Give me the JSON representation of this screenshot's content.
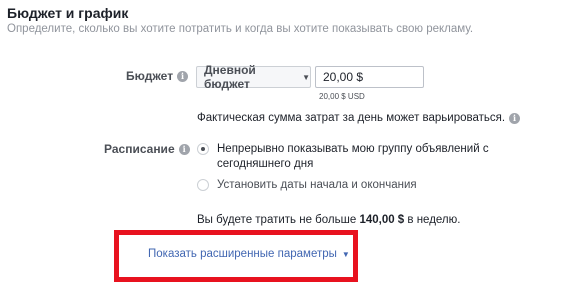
{
  "section": {
    "title": "Бюджет и график",
    "subtitle": "Определите, сколько вы хотите потратить и когда вы хотите показывать свою рекламу."
  },
  "budget": {
    "label": "Бюджет",
    "type_select": "Дневной бюджет",
    "amount_value": "20,00 $",
    "amount_usd": "20,00 $ USD",
    "note": "Фактическая сумма затрат за день может варьироваться."
  },
  "schedule": {
    "label": "Расписание",
    "options": [
      {
        "label": "Непрерывно показывать мою группу объявлений с сегодняшнего дня",
        "selected": true
      },
      {
        "label": "Установить даты начала и окончания",
        "selected": false
      }
    ]
  },
  "spend_summary": {
    "prefix": "Вы будете тратить не больше ",
    "amount": "140,00 $",
    "suffix": " в неделю."
  },
  "advanced": {
    "link_label": "Показать расширенные параметры"
  },
  "icons": {
    "info": "info-icon",
    "caret": "chevron-down-icon"
  },
  "colors": {
    "link": "#4267b2",
    "highlight": "#e8121f"
  }
}
